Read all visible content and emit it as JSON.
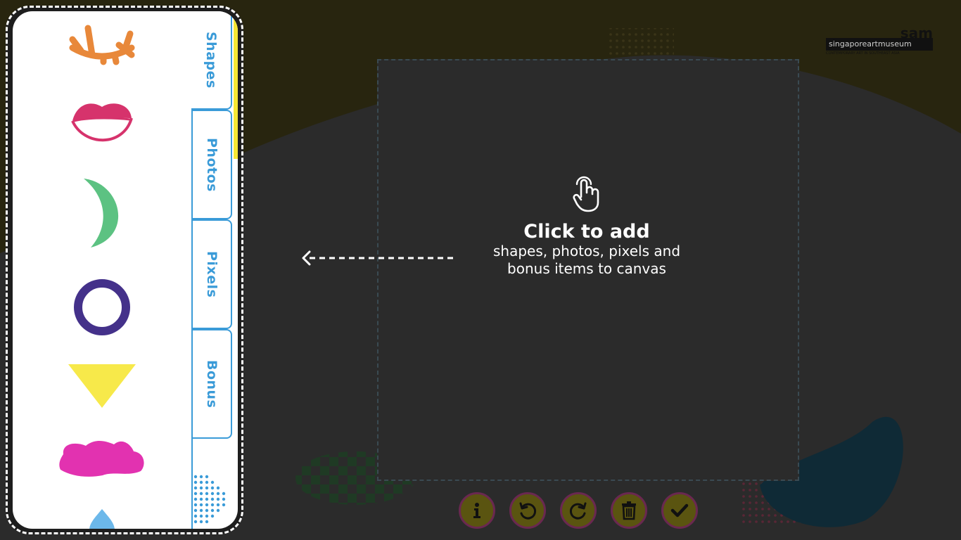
{
  "tabs": [
    {
      "label": "Shapes",
      "active": true
    },
    {
      "label": "Photos",
      "active": false
    },
    {
      "label": "Pixels",
      "active": false
    },
    {
      "label": "Bonus",
      "active": false
    }
  ],
  "shapes": [
    {
      "name": "closed-eye-icon",
      "color": "#e8883a"
    },
    {
      "name": "lips-icon",
      "color": "#d6336c"
    },
    {
      "name": "crescent-icon",
      "color": "#5cc282"
    },
    {
      "name": "ring-icon",
      "color": "#44318a"
    },
    {
      "name": "triangle-icon",
      "color": "#f7e94a"
    },
    {
      "name": "blob-icon",
      "color": "#e232b0"
    },
    {
      "name": "drop-icon",
      "color": "#6cb8ea"
    }
  ],
  "hint": {
    "title": "Click to add",
    "line1": "shapes, photos, pixels and",
    "line2": "bonus items to canvas"
  },
  "toolbar": {
    "info": "info-icon",
    "undo": "undo-icon",
    "redo": "redo-icon",
    "delete": "trash-icon",
    "confirm": "check-icon"
  },
  "logo": {
    "short": "sam",
    "full": "singaporeartmuseum",
    "tagline": "CONTEMPORARY ART IN SOUTHEAST ASIA"
  },
  "colors": {
    "accent_blue": "#3a9bd8",
    "background": "#2b2b2b",
    "top_band": "#28250f"
  }
}
